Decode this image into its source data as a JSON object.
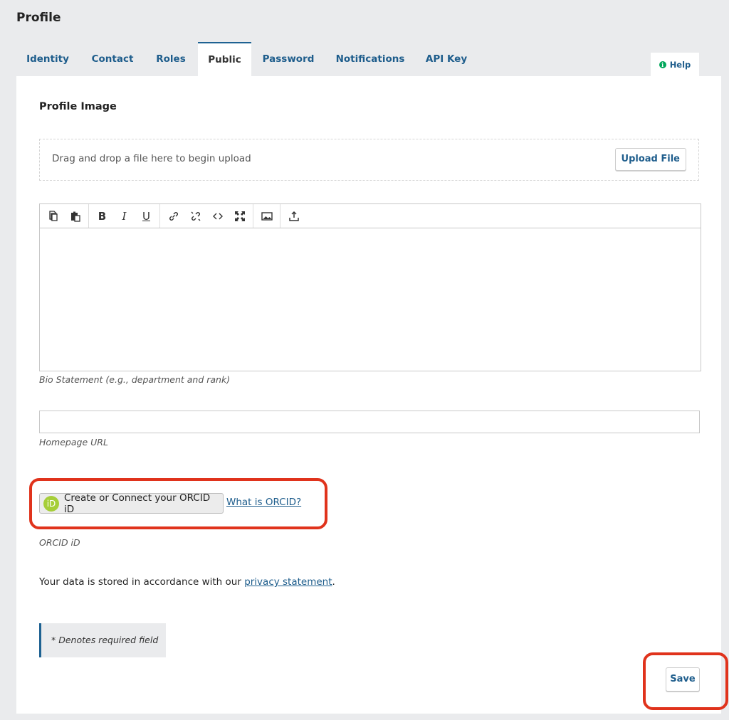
{
  "page": {
    "title": "Profile"
  },
  "tabs": [
    {
      "label": "Identity"
    },
    {
      "label": "Contact"
    },
    {
      "label": "Roles"
    },
    {
      "label": "Public",
      "active": true
    },
    {
      "label": "Password"
    },
    {
      "label": "Notifications"
    },
    {
      "label": "API Key"
    }
  ],
  "help": {
    "label": "Help",
    "icon": "info-icon"
  },
  "profile_image": {
    "title": "Profile Image",
    "drop_text": "Drag and drop a file here to begin upload",
    "upload_label": "Upload File"
  },
  "editor": {
    "toolbar_icons": [
      "copy-icon",
      "paste-icon",
      "bold-icon",
      "italic-icon",
      "underline-icon",
      "link-icon",
      "unlink-icon",
      "code-icon",
      "fullscreen-icon",
      "image-icon",
      "upload-icon"
    ],
    "value": "",
    "label": "Bio Statement (e.g., department and rank)"
  },
  "homepage": {
    "value": "",
    "label": "Homepage URL"
  },
  "orcid": {
    "button_label": "Create or Connect your ORCID iD",
    "icon_text": "iD",
    "link_text": "What is ORCID?",
    "label": "ORCID iD"
  },
  "privacy": {
    "prefix": "Your data is stored in accordance with our ",
    "link_text": "privacy statement",
    "suffix": "."
  },
  "required_note": "* Denotes required field",
  "save_label": "Save",
  "colors": {
    "link": "#1e5d8c",
    "highlight": "#e0331c",
    "orcid": "#a6ce39"
  }
}
